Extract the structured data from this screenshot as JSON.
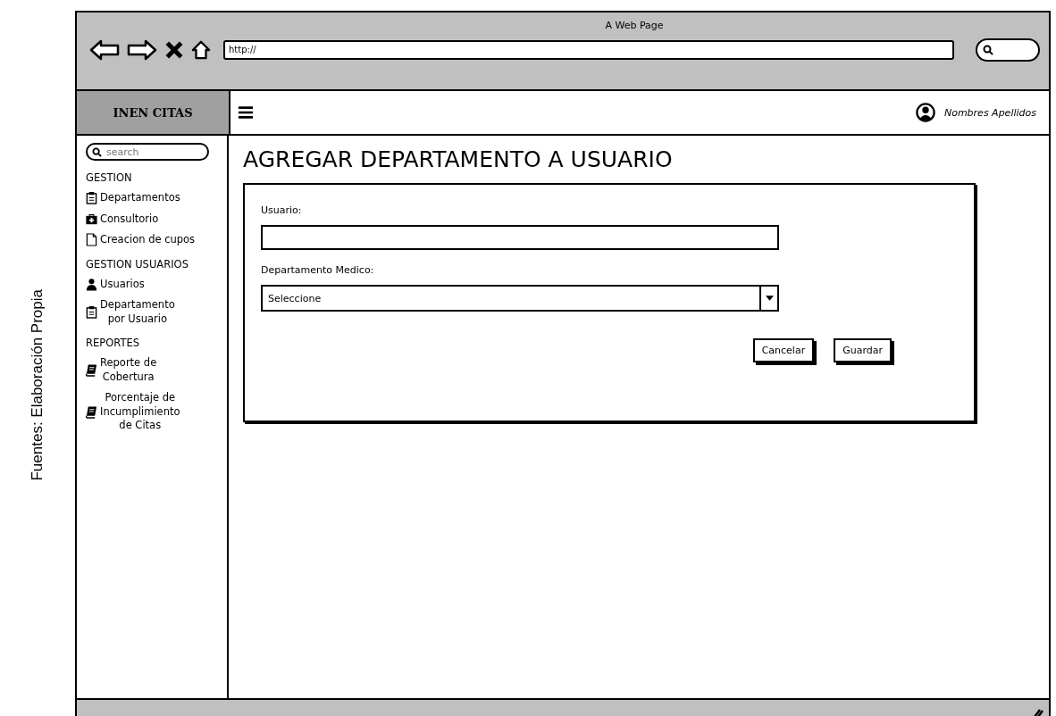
{
  "caption": "Fuentes: Elaboración Propia",
  "browser": {
    "title": "A Web Page",
    "url": "http://"
  },
  "app": {
    "brand": "INEN CITAS",
    "user": "Nombres Apellidos"
  },
  "sidebar": {
    "search": {
      "placeholder": "search"
    },
    "items": [
      {
        "kind": "header",
        "label": "GESTION"
      },
      {
        "kind": "item",
        "lines": [
          "Departamentos"
        ]
      },
      {
        "kind": "item",
        "lines": [
          "Consultorio"
        ]
      },
      {
        "kind": "item",
        "lines": [
          "Creacion de cupos"
        ]
      },
      {
        "kind": "header",
        "label": "GESTION USUARIOS"
      },
      {
        "kind": "item",
        "lines": [
          "Usuarios"
        ]
      },
      {
        "kind": "item",
        "lines": [
          "Departamento",
          "por Usuario"
        ]
      },
      {
        "kind": "header",
        "label": "REPORTES"
      },
      {
        "kind": "item",
        "lines": [
          "Reporte de",
          "Cobertura"
        ]
      },
      {
        "kind": "item",
        "lines": [
          "Porcentaje de",
          "Incumplimiento",
          "de Citas"
        ]
      }
    ]
  },
  "page": {
    "title": "AGREGAR DEPARTAMENTO A USUARIO",
    "fields": [
      {
        "kind": "text",
        "label": "Usuario:"
      },
      {
        "kind": "select",
        "label": "Departamento Medico:",
        "value": "Seleccione"
      }
    ],
    "buttons": [
      "Cancelar",
      "Guardar"
    ]
  }
}
